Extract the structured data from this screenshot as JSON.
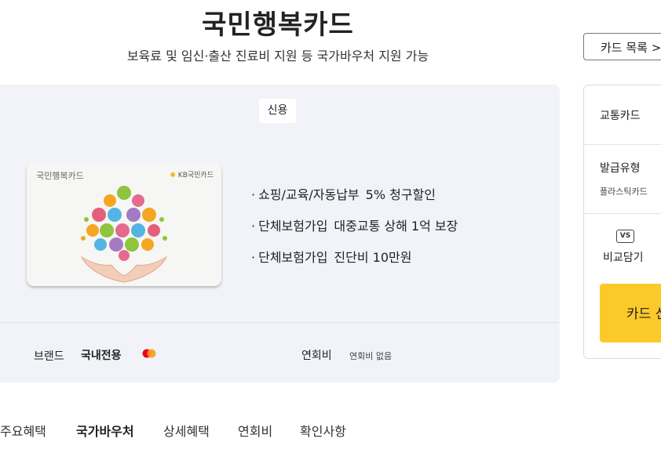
{
  "header": {
    "title": "국민행복카드",
    "subtitle": "보육료 및 임신·출산 진료비 지원 등 국가바우처 지원 가능",
    "list_button": "카드 목록 >"
  },
  "card": {
    "type_badge": "신용",
    "image_brand_text": "국민행복카드",
    "image_issuer_text": "KB국민카드",
    "benefits": [
      {
        "label": "쇼핑/교육/자동납부",
        "value": "5% 청구할인"
      },
      {
        "label": "단체보험가입",
        "value": "대중교통 상해 1억 보장"
      },
      {
        "label": "단체보험가입",
        "value": "진단비 10만원"
      }
    ],
    "brand_label": "브랜드",
    "brand_value": "국내전용",
    "annual_fee_label": "연회비",
    "annual_fee_value": "연회비 없음"
  },
  "side": {
    "transit": "교통카드",
    "issue_type_label": "발급유형",
    "issue_type_value": "플라스틱카드",
    "vs_icon_text": "VS",
    "compare_label": "비교담기",
    "apply_button": "카드 신청"
  },
  "tabs": [
    "주요혜택",
    "국가바우처",
    "상세혜택",
    "연회비",
    "확인사항"
  ],
  "colors": {
    "panel_bg": "#f1f3f8",
    "apply_button": "#fbc92a"
  }
}
